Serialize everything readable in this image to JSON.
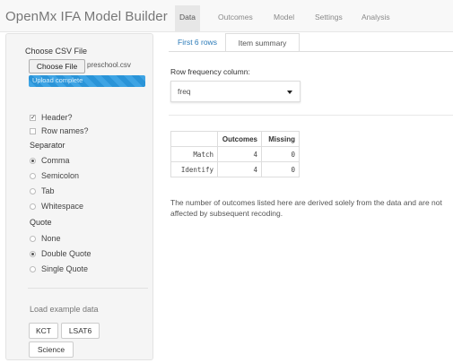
{
  "navbar": {
    "brand": "OpenMx IFA Model Builder",
    "tabs": [
      "Data",
      "Outcomes",
      "Model",
      "Settings",
      "Analysis"
    ]
  },
  "sidebar": {
    "csv_label": "Choose CSV File",
    "choose_file_label": "Choose File",
    "file_name": "preschool.csv",
    "upload_status": "Upload complete",
    "upload_progress": 1.0,
    "header_label": "Header?",
    "header_checked": true,
    "rownames_label": "Row names?",
    "rownames_checked": false,
    "separator_label": "Separator",
    "separator_options": [
      "Comma",
      "Semicolon",
      "Tab",
      "Whitespace"
    ],
    "separator_selected": "Comma",
    "quote_label": "Quote",
    "quote_options": [
      "None",
      "Double Quote",
      "Single Quote"
    ],
    "quote_selected": "Double Quote",
    "example_label": "Load example data",
    "example_buttons": [
      "KCT",
      "LSAT6",
      "Science"
    ]
  },
  "main": {
    "tabs": [
      "First 6 rows",
      "Item summary"
    ],
    "active_tab": "Item summary",
    "freq_label": "Row frequency column:",
    "freq_value": "freq",
    "table": {
      "headers": [
        "",
        "Outcomes",
        "Missing"
      ],
      "rows": [
        [
          "Match",
          "4",
          "0"
        ],
        [
          "Identify",
          "4",
          "0"
        ]
      ]
    },
    "note": "The number of outcomes listed here are derived solely from the data and are not affected by subsequent recoding."
  }
}
